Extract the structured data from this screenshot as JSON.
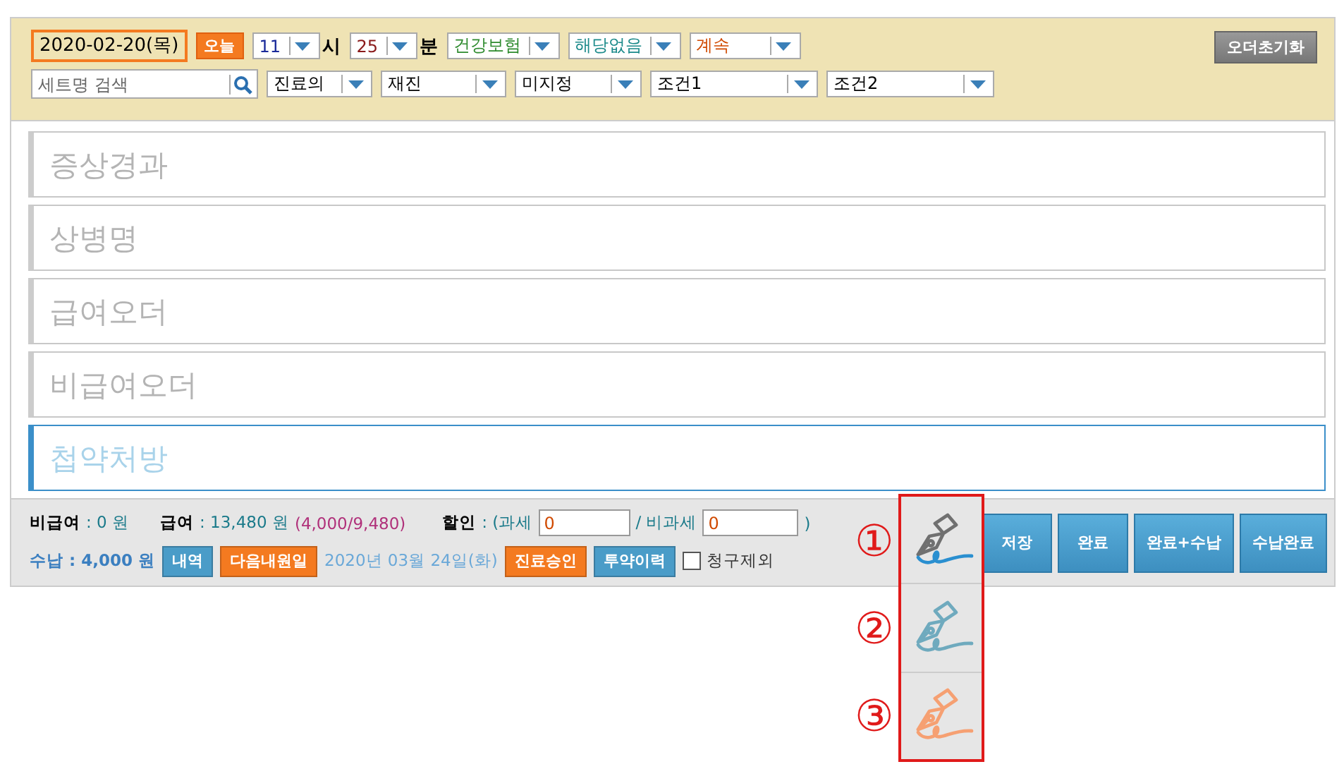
{
  "header": {
    "date": "2020-02-20(목)",
    "today_button": "오늘",
    "selects": [
      {
        "value": "11",
        "color": "#1a2a9a",
        "unit": "시"
      },
      {
        "value": "25",
        "color": "#8a1a1a",
        "unit": "분"
      },
      {
        "value": "건강보험",
        "color": "#2e8b2e"
      },
      {
        "value": "해당없음",
        "color": "#1b8a8a"
      },
      {
        "value": "계속",
        "color": "#d04a00"
      }
    ],
    "reset_button": "오더초기화",
    "search": {
      "placeholder": "세트명 검색"
    },
    "filters": [
      {
        "value": "진료의"
      },
      {
        "value": "재진"
      },
      {
        "value": "미지정"
      },
      {
        "value": "조건1"
      },
      {
        "value": "조건2"
      }
    ]
  },
  "sections": [
    {
      "label": "증상경과",
      "selected": false
    },
    {
      "label": "상병명",
      "selected": false
    },
    {
      "label": "급여오더",
      "selected": false
    },
    {
      "label": "비급여오더",
      "selected": false
    },
    {
      "label": "첩약처방",
      "selected": true
    }
  ],
  "summary": {
    "non_covered": {
      "label": "비급여",
      "value": ": 0 원"
    },
    "covered": {
      "label": "급여",
      "value": ": 13,480 원",
      "breakdown": "(4,000/9,480)"
    },
    "discount": {
      "label": "할인",
      "taxable_label": ": (과세",
      "taxable": "0",
      "nontaxable_label": "/ 비과세",
      "nontaxable": "0",
      "close": ")"
    }
  },
  "payment": {
    "label": "수납 : 4,000 원"
  },
  "tools": [
    {
      "kind": "button",
      "label": "내역",
      "color": "#4a9cc8"
    },
    {
      "kind": "button",
      "label": "다음내원일",
      "color": "#f47a20"
    },
    {
      "kind": "text",
      "label": "2020년 03월 24일(화)"
    },
    {
      "kind": "button",
      "label": "진료승인",
      "color": "#f47a20"
    },
    {
      "kind": "button",
      "label": "투약이력",
      "color": "#4a9cc8"
    },
    {
      "kind": "checkbox",
      "label": "청구제외",
      "checked": false
    }
  ],
  "actions": [
    "저장",
    "완료",
    "완료+수납",
    "수납완료"
  ],
  "pens": [
    {
      "label": "①",
      "kind": "normal",
      "color": "#2a8fd0"
    },
    {
      "label": "②",
      "kind": "tinted",
      "color": "#6faabe"
    },
    {
      "label": "③",
      "kind": "tinted",
      "color": "#f6a072"
    }
  ]
}
